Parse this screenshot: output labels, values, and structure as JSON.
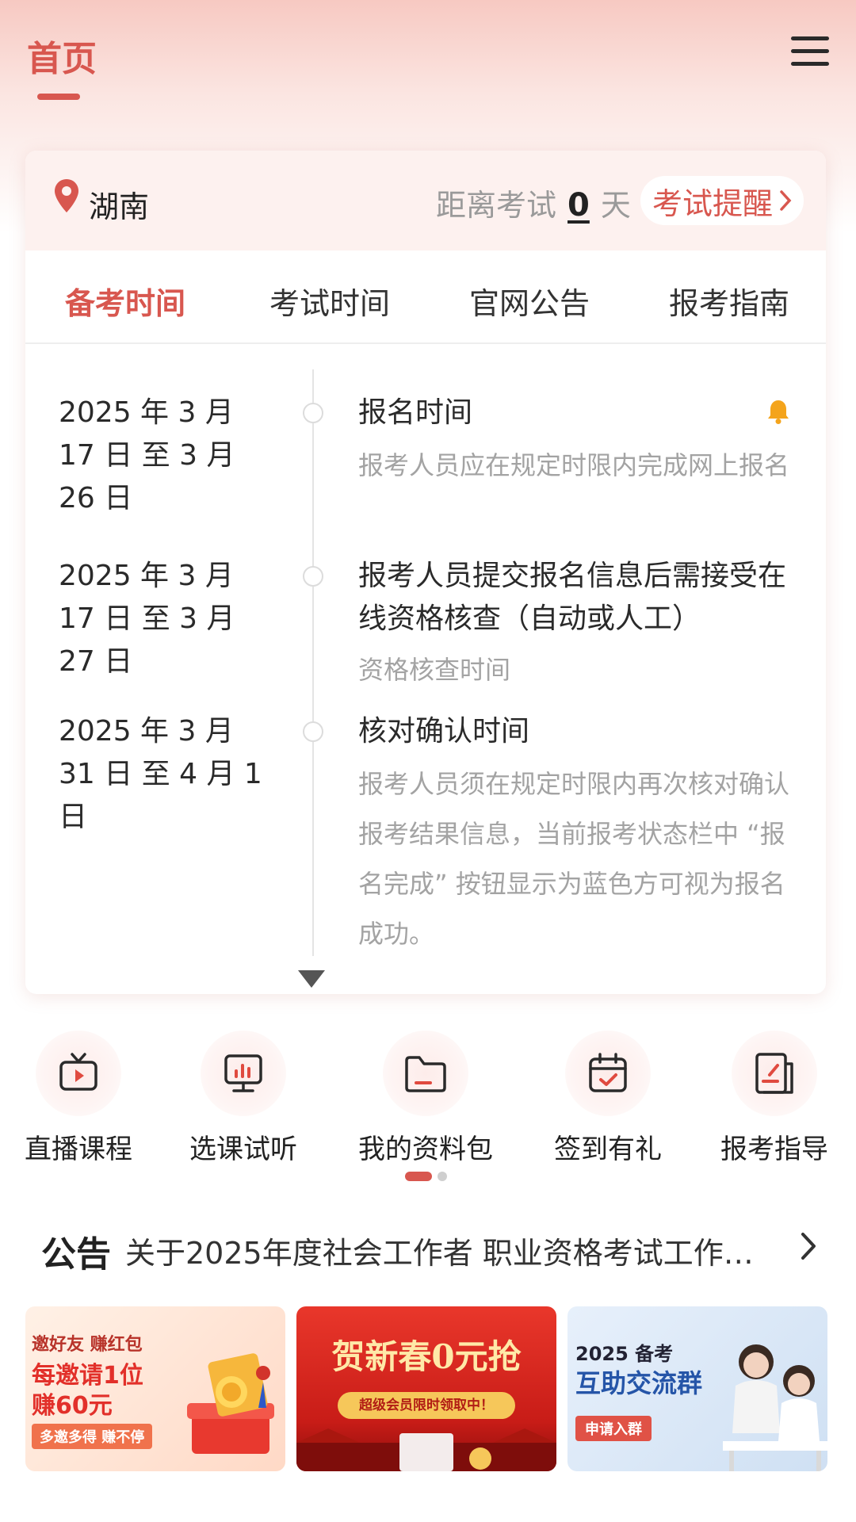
{
  "header": {
    "title": "首页"
  },
  "location": {
    "name": "湖南"
  },
  "countdown": {
    "prefix": "距离考试",
    "days": "0",
    "suffix": "天",
    "remind_label": "考试提醒"
  },
  "tabs": [
    {
      "label": "备考时间",
      "active": true
    },
    {
      "label": "考试时间",
      "active": false
    },
    {
      "label": "官网公告",
      "active": false
    },
    {
      "label": "报考指南",
      "active": false
    }
  ],
  "timeline": [
    {
      "date": "2025 年 3 月 17 日 至 3 月 26 日",
      "title": "报名时间",
      "desc": "报考人员应在规定时限内完成网上报名"
    },
    {
      "date": "2025 年 3 月 17 日 至 3 月 27 日",
      "title": "报考人员提交报名信息后需接受在线资格核查（自动或人工）",
      "desc": "资格核查时间"
    },
    {
      "date": "2025 年 3 月 31 日 至 4 月 1 日",
      "title": "核对确认时间",
      "desc": "报考人员须在规定时限内再次核对确认报考结果信息，当前报考状态栏中 “报名完成” 按钮显示为蓝色方可视为报名成功。"
    }
  ],
  "quick_actions": [
    {
      "label": "直播课程",
      "icon": "tv-play-icon"
    },
    {
      "label": "选课试听",
      "icon": "presentation-chart-icon"
    },
    {
      "label": "我的资料包",
      "icon": "folder-icon"
    },
    {
      "label": "签到有礼",
      "icon": "calendar-check-icon"
    },
    {
      "label": "报考指导",
      "icon": "document-pen-icon"
    }
  ],
  "notice": {
    "label": "公告",
    "text": "关于2025年度社会工作者 职业资格考试工作…"
  },
  "banners": [
    {
      "line1": "邀好友 赚红包",
      "line2": "每邀请1位",
      "line3": "赚60元",
      "pill": "多邀多得 赚不停"
    },
    {
      "line1": "贺新春0元抢",
      "ribbon": "超级会员限时领取中！"
    },
    {
      "line1": "2025 备考",
      "line2": "互助交流群",
      "pill": "申请入群"
    }
  ],
  "colors": {
    "accent": "#d8574f",
    "muted": "#a3a3a3"
  }
}
